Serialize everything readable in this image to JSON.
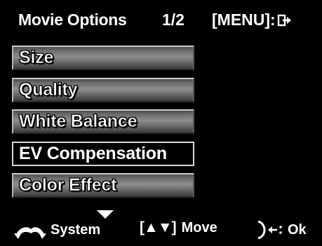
{
  "header": {
    "title": "Movie Options",
    "page": "1/2",
    "menu_hint": "[MENU]:"
  },
  "menu": {
    "items": [
      {
        "label": "Size"
      },
      {
        "label": "Quality"
      },
      {
        "label": "White Balance"
      },
      {
        "label": "EV Compensation",
        "selected": true
      },
      {
        "label": "Color Effect"
      }
    ]
  },
  "footer": {
    "system_label": "System",
    "move_glyph": "[▲▼]",
    "move_label": "Move",
    "ok_label": "Ok"
  },
  "icons": {
    "exit": "exit-arrow-icon",
    "dial": "mode-dial-icon",
    "move": "up-down-arrows-icon",
    "ok": "ok-arrow-icon",
    "more": "scroll-down-icon"
  },
  "colors": {
    "background": "#000000",
    "text": "#ffffff",
    "item_gradient_mid": "#8d8d8d",
    "selected_bg": "#000000"
  }
}
